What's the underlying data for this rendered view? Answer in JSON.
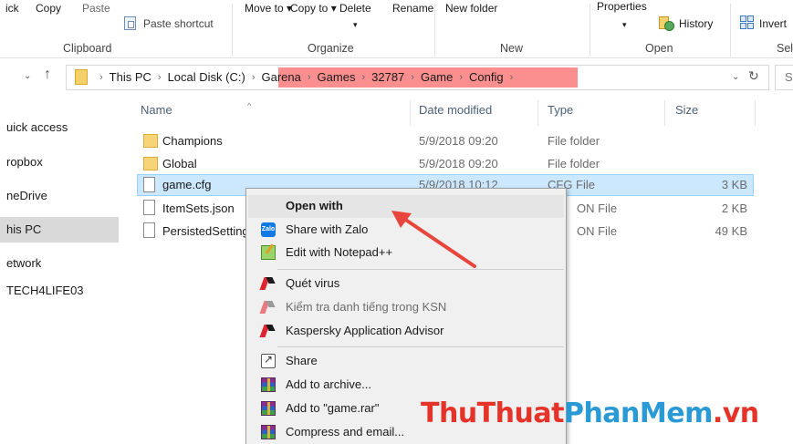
{
  "ribbon": {
    "clipboard": {
      "copy_path": "ick",
      "copy": "Copy",
      "paste": "Paste",
      "paste_shortcut": "Paste shortcut",
      "group": "Clipboard"
    },
    "organize": {
      "move_to": "Move to ▾",
      "copy_to": "Copy to ▾",
      "delete": "Delete",
      "rename": "Rename",
      "delete_caret": "▾",
      "group": "Organize"
    },
    "new": {
      "new_folder": "New folder",
      "group": "New"
    },
    "open": {
      "properties": "Properties",
      "properties_caret": "▾",
      "history": "History",
      "group": "Open"
    },
    "select": {
      "invert": "Invert",
      "group": "Sel"
    }
  },
  "address": {
    "nav_down": "⌄",
    "nav_up": "↑",
    "crumbs": [
      "This PC",
      "Local Disk (C:)",
      "Garena",
      "Games",
      "32787",
      "Game",
      "Config"
    ],
    "dropdown": "⌄",
    "refresh": "↻",
    "search_letter": "S"
  },
  "navpane": {
    "items": [
      "uick access",
      "ropbox",
      "neDrive",
      "his PC",
      "etwork",
      "TECH4LIFE03"
    ]
  },
  "columns": {
    "name": "Name",
    "date": "Date modified",
    "type": "Type",
    "size": "Size",
    "sort_caret": "^"
  },
  "files": [
    {
      "name": "Champions",
      "date": "5/9/2018 09:20",
      "type": "File folder",
      "size": ""
    },
    {
      "name": "Global",
      "date": "5/9/2018 09:20",
      "type": "File folder",
      "size": ""
    },
    {
      "name": "game.cfg",
      "date": "5/9/2018 10:12",
      "type": "CFG File",
      "size": "3 KB"
    },
    {
      "name": "ItemSets.json",
      "date": "",
      "type": "ON File",
      "size": "2 KB"
    },
    {
      "name": "PersistedSetting",
      "date": "",
      "type": "ON File",
      "size": "49 KB"
    }
  ],
  "context_menu": {
    "open_with": "Open with",
    "share_zalo": "Share with Zalo",
    "zalo_badge": "Zalo",
    "notepadpp": "Edit with Notepad++",
    "scan_virus": "Quét virus",
    "ksn": "Kiểm tra danh tiếng trong KSN",
    "kaspersky_advisor": "Kaspersky Application Advisor",
    "share": "Share",
    "add_archive": "Add to archive...",
    "add_rar": "Add to \"game.rar\"",
    "compress_email": "Compress and email..."
  },
  "watermark": {
    "part1": "ThuThuat",
    "part2": "PhanMem",
    "part3": ".vn"
  },
  "colors": {
    "highlight": "#fb8f8f",
    "selection": "#cce8ff",
    "arrow": "#e8453c",
    "wm_red": "#e63329",
    "wm_blue": "#2a9ad6"
  }
}
